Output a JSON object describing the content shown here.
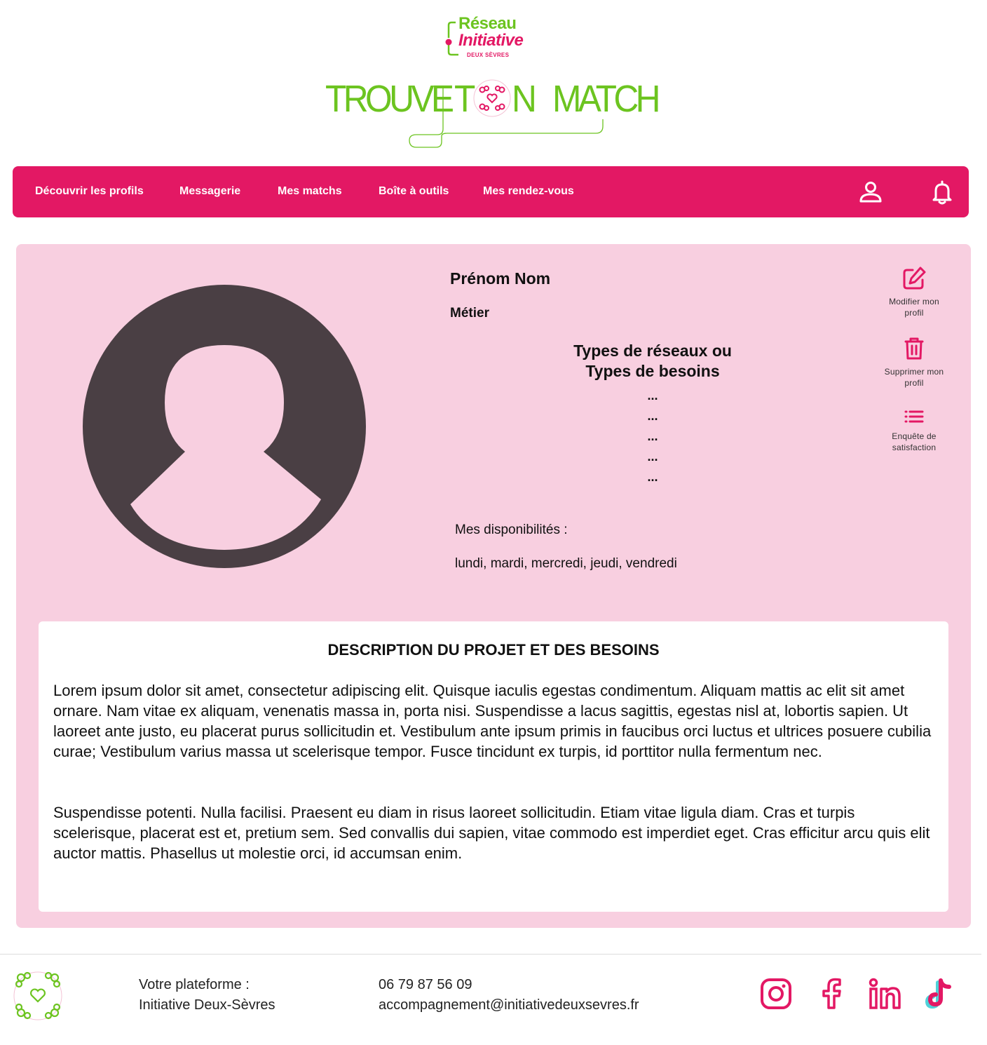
{
  "header": {
    "brand_line1": "Réseau",
    "brand_line2": "Initiative",
    "brand_line3": "DEUX SÈVRES",
    "app_title_word1": "TROUVE",
    "app_title_t": "T",
    "app_title_n": "N",
    "app_title_word3": "MATCH"
  },
  "nav": {
    "items": [
      {
        "label": "Découvrir les profils"
      },
      {
        "label": "Messagerie"
      },
      {
        "label": "Mes matchs"
      },
      {
        "label": "Boîte à outils"
      },
      {
        "label": "Mes rendez-vous"
      }
    ],
    "icons": [
      "user-icon",
      "bell-icon"
    ]
  },
  "profile": {
    "name": "Prénom Nom",
    "job": "Métier",
    "types_title_line1": "Types de réseaux ou",
    "types_title_line2": "Types de besoins",
    "types_items": [
      "...",
      "...",
      "...",
      "...",
      "..."
    ],
    "dispo_label": "Mes disponibilités :",
    "dispo_value": "lundi, mardi, mercredi, jeudi, vendredi",
    "actions": [
      {
        "line1": "Modifier mon",
        "line2": "profil",
        "icon": "edit-icon"
      },
      {
        "line1": "Supprimer mon",
        "line2": "profil",
        "icon": "trash-icon"
      },
      {
        "line1": "Enquête de",
        "line2": "satisfaction",
        "icon": "list-icon"
      }
    ]
  },
  "description": {
    "title": "DESCRIPTION DU PROJET ET DES BESOINS",
    "paragraph1": "Lorem ipsum dolor sit amet, consectetur adipiscing elit. Quisque iaculis egestas condimentum. Aliquam mattis ac elit sit amet ornare. Nam vitae ex aliquam, venenatis massa in, porta nisi. Suspendisse a lacus sagittis, egestas nisl at, lobortis sapien. Ut laoreet ante justo, eu placerat purus sollicitudin et. Vestibulum ante ipsum primis in faucibus orci luctus et ultrices posuere cubilia curae; Vestibulum varius massa ut scelerisque tempor. Fusce tincidunt ex turpis, id porttitor nulla fermentum nec.",
    "paragraph2": "Suspendisse potenti. Nulla facilisi. Praesent eu diam in risus laoreet sollicitudin. Etiam vitae ligula diam. Cras et turpis scelerisque, placerat est et, pretium sem. Sed convallis dui sapien, vitae commodo est imperdiet eget. Cras efficitur arcu quis elit auctor mattis. Phasellus ut molestie orci, id accumsan enim."
  },
  "footer": {
    "platform_line1": "Votre plateforme :",
    "platform_line2": "Initiative Deux-Sèvres",
    "phone": "06 79 87 56 09",
    "email": "accompagnement@initiativedeuxsevres.fr",
    "socials": [
      "instagram-icon",
      "facebook-icon",
      "linkedin-icon",
      "tiktok-icon"
    ]
  },
  "colors": {
    "accent": "#e31864",
    "green": "#6cc420",
    "card_bg": "#f8cfe0",
    "avatar": "#4a3f44"
  }
}
